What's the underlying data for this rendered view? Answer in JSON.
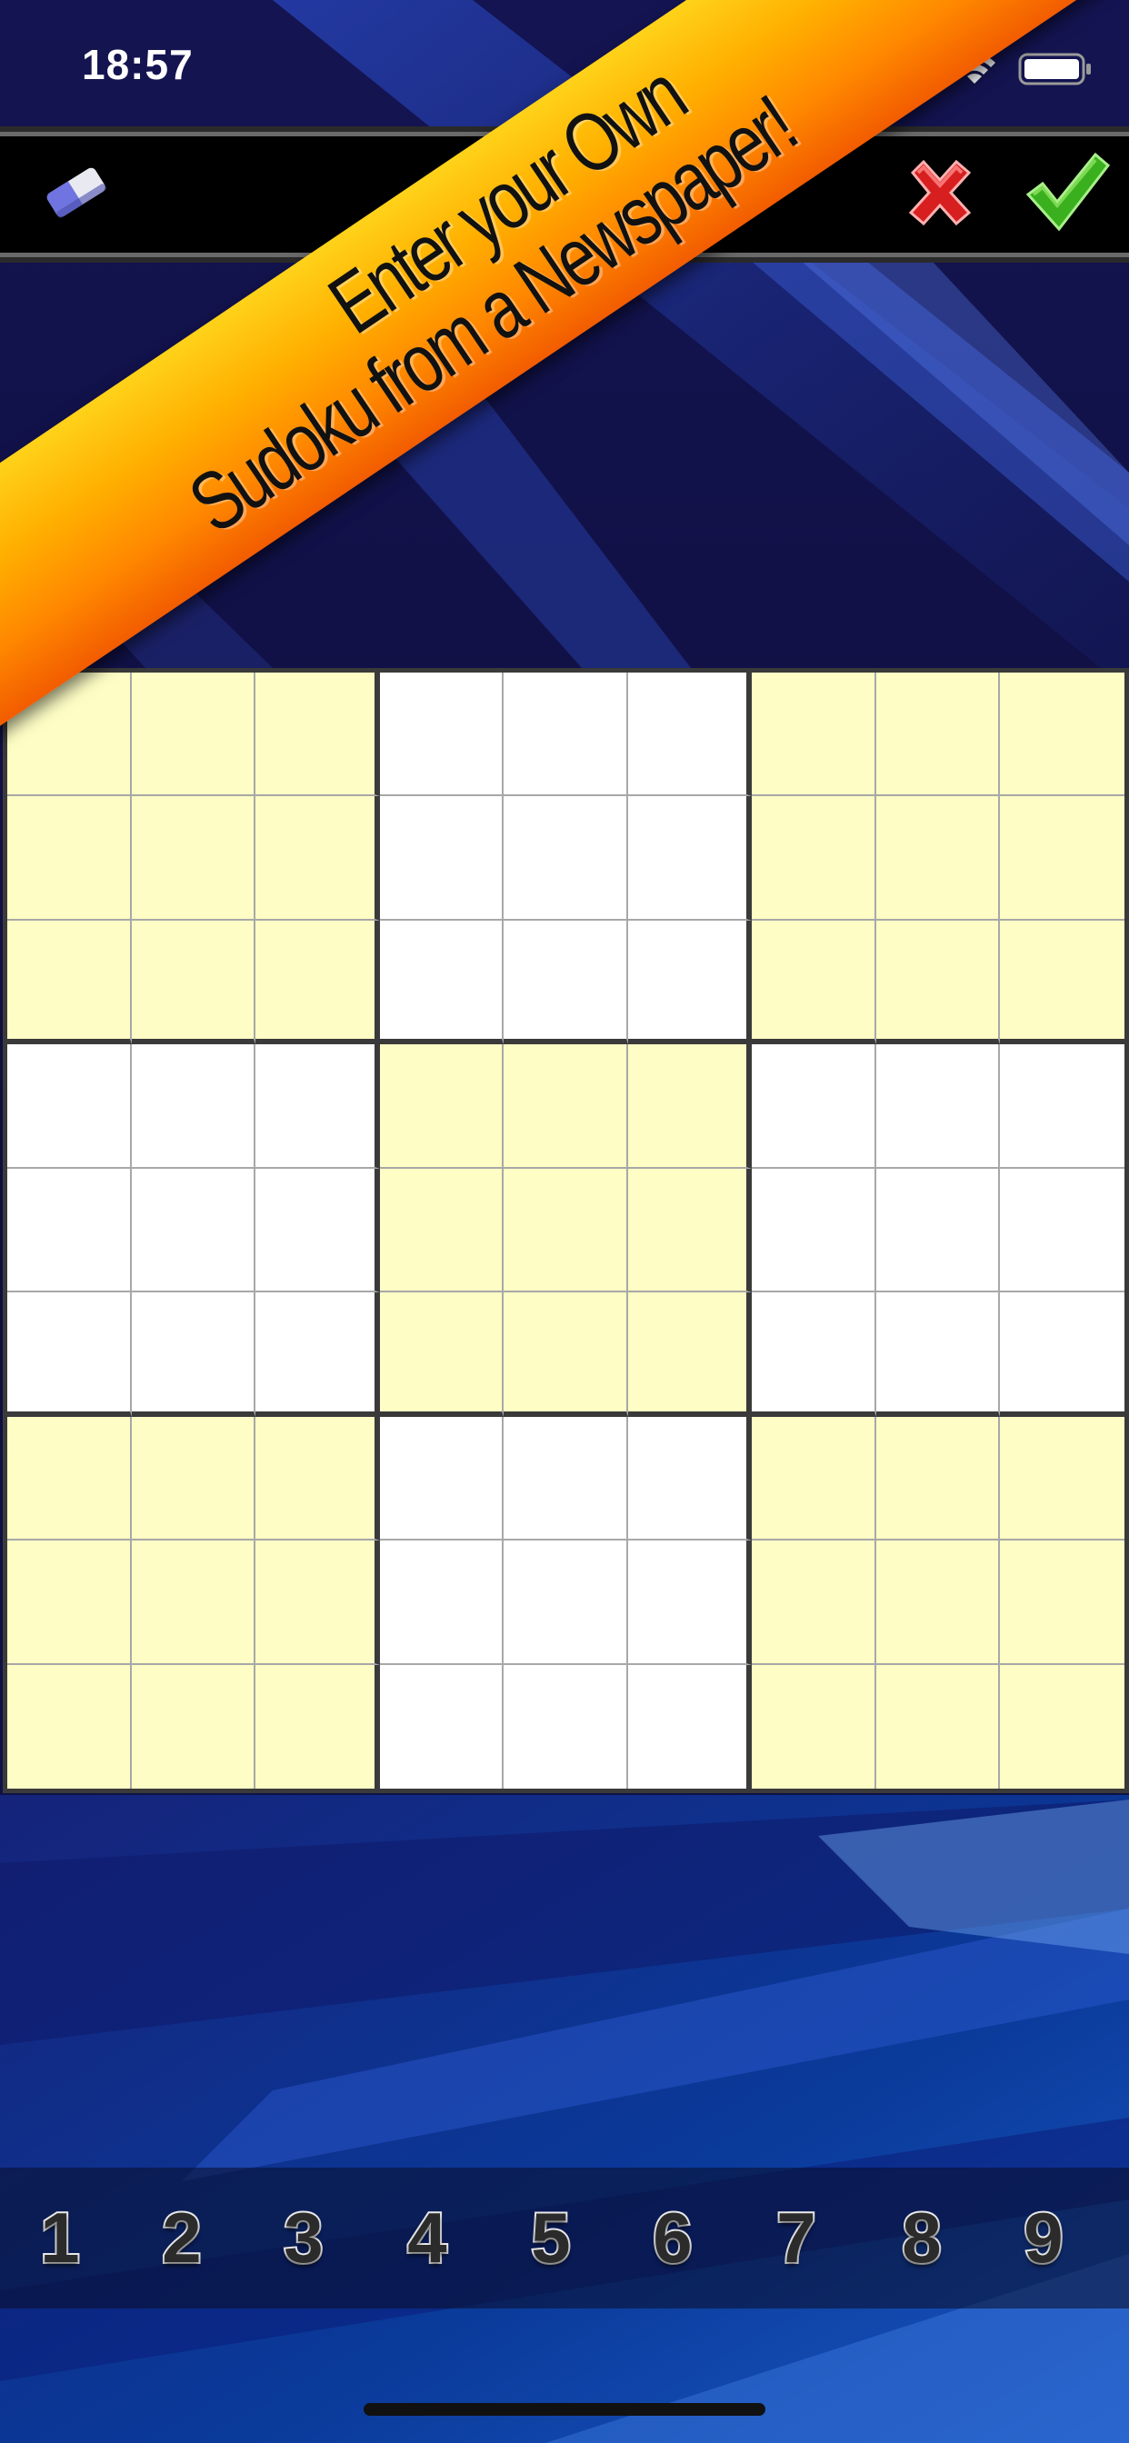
{
  "status_bar": {
    "time": "18:57"
  },
  "toolbar": {
    "eraser_icon": "eraser-icon",
    "cancel_icon": "red-x-icon",
    "confirm_icon": "green-check-icon",
    "cancel_color": "#e62222",
    "confirm_color": "#3ab01f"
  },
  "banner": {
    "line1": "Enter your Own",
    "line2": "Sudoku from a Newspaper!",
    "colors": [
      "#ffd21a",
      "#f25c00"
    ]
  },
  "grid": {
    "size": 9,
    "values": [
      [
        "",
        "",
        "",
        "",
        "",
        "",
        "",
        "",
        ""
      ],
      [
        "",
        "",
        "",
        "",
        "",
        "",
        "",
        "",
        ""
      ],
      [
        "",
        "",
        "",
        "",
        "",
        "",
        "",
        "",
        ""
      ],
      [
        "",
        "",
        "",
        "",
        "",
        "",
        "",
        "",
        ""
      ],
      [
        "",
        "",
        "",
        "",
        "",
        "",
        "",
        "",
        ""
      ],
      [
        "",
        "",
        "",
        "",
        "",
        "",
        "",
        "",
        ""
      ],
      [
        "",
        "",
        "",
        "",
        "",
        "",
        "",
        "",
        ""
      ],
      [
        "",
        "",
        "",
        "",
        "",
        "",
        "",
        "",
        ""
      ],
      [
        "",
        "",
        "",
        "",
        "",
        "",
        "",
        "",
        ""
      ]
    ],
    "tint_color": "#fdfdc5"
  },
  "numpad": {
    "keys": [
      "1",
      "2",
      "3",
      "4",
      "5",
      "6",
      "7",
      "8",
      "9"
    ]
  }
}
